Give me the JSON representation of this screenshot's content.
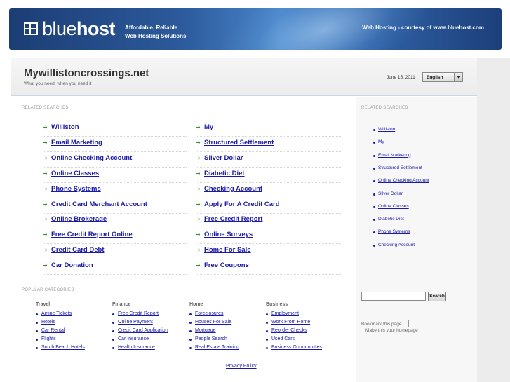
{
  "banner": {
    "logo_light": "blue",
    "logo_bold": "host",
    "tagline_line1": "Affordable, Reliable",
    "tagline_line2": "Web Hosting Solutions",
    "courtesy": "Web Hosting - courtesy of www.bluehost.com"
  },
  "site": {
    "title": "Mywillistoncrossings.net",
    "subtitle": "What you need, when you need it",
    "date": "June 15, 2011",
    "language": "English"
  },
  "related": {
    "label": "RELATED SEARCHES",
    "col1": [
      "Williston",
      "Email Marketing",
      "Online Checking Account",
      "Online Classes",
      "Phone Systems",
      "Credit Card Merchant Account",
      "Online Brokerage",
      "Free Credit Report Online",
      "Credit Card Debt",
      "Car Donation"
    ],
    "col2": [
      "My",
      "Structured Settlement",
      "Silver Dollar",
      "Diabetic Diet",
      "Checking Account",
      "Apply For A Credit Card",
      "Free Credit Report",
      "Online Surveys",
      "Home For Sale",
      "Free Coupons"
    ]
  },
  "sidebar": {
    "label": "RELATED SEARCHES",
    "items": [
      "Williston",
      "My",
      "Email Marketing",
      "Structured Settlement",
      "Online Checking Account",
      "Silver Dollar",
      "Online Classes",
      "Diabetic Diet",
      "Phone Systems",
      "Checking Account"
    ],
    "search_button": "Search",
    "bookmark": "Bookmark this page",
    "homepage": "Make this your homepage"
  },
  "popular": {
    "label": "POPULAR CATEGORIES",
    "categories": [
      {
        "name": "Travel",
        "items": [
          "Airline Tickets",
          "Hotels",
          "Car Rental",
          "Flights",
          "South Beach Hotels"
        ]
      },
      {
        "name": "Finance",
        "items": [
          "Free Credit Report",
          "Online Payment",
          "Credit Card Application",
          "Car Insurance",
          "Health Insurance"
        ]
      },
      {
        "name": "Home",
        "items": [
          "Foreclosures",
          "Houses For Sale",
          "Mortgage",
          "People Search",
          "Real Estate Training"
        ]
      },
      {
        "name": "Business",
        "items": [
          "Employment",
          "Work From Home",
          "Reorder Checks",
          "Used Cars",
          "Business Opportunities"
        ]
      }
    ]
  },
  "footer": {
    "privacy": "Privacy Policy"
  },
  "colors": {
    "link": "#1a1aa6",
    "bullet_green": "#3b8c3b",
    "banner_blue": "#2c5a9c"
  }
}
